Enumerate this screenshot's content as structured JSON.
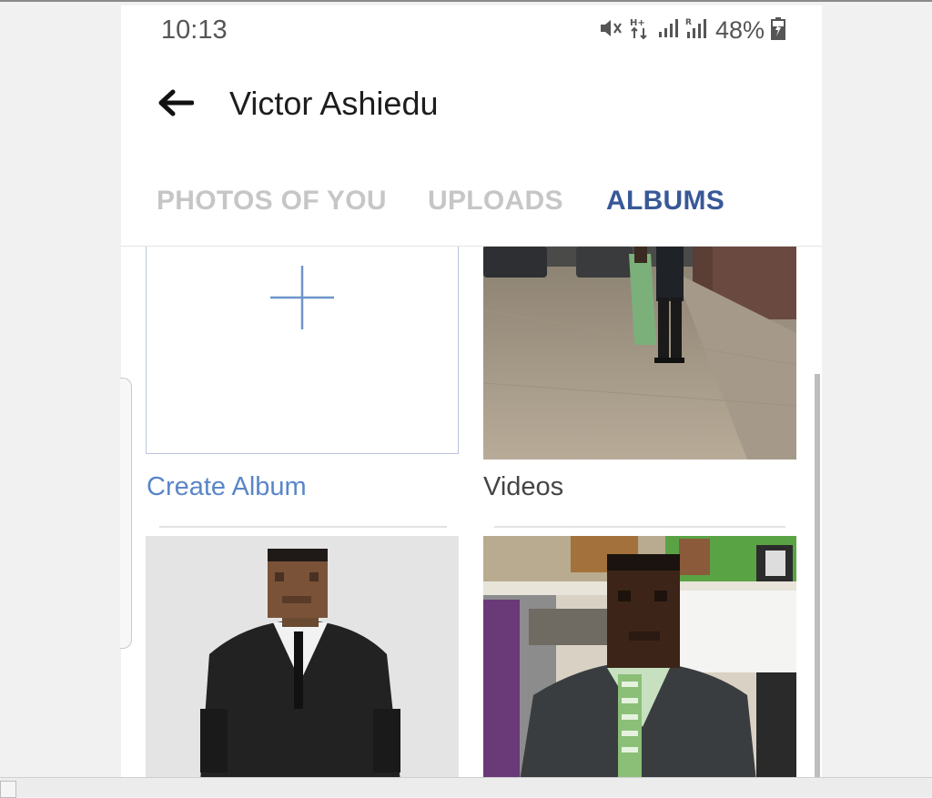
{
  "status_bar": {
    "time": "10:13",
    "network_label": "H+",
    "roaming_label": "R",
    "battery": "48%",
    "icons": [
      "mute-icon",
      "network-data-icon",
      "signal-icon",
      "roaming-signal-icon",
      "battery-charging-icon"
    ]
  },
  "header": {
    "back_icon": "arrow-left-icon",
    "title": "Victor Ashiedu"
  },
  "tabs": [
    {
      "label": "PHOTOS OF YOU",
      "active": false
    },
    {
      "label": "UPLOADS",
      "active": false
    },
    {
      "label": "ALBUMS",
      "active": true
    }
  ],
  "albums": [
    {
      "label": "Create Album",
      "icon": "plus-icon"
    },
    {
      "label": "Videos"
    },
    {
      "label": ""
    },
    {
      "label": ""
    }
  ],
  "colors": {
    "accent": "#385898",
    "link": "#5a86c9",
    "inactive_tab": "#c6c6c6"
  }
}
